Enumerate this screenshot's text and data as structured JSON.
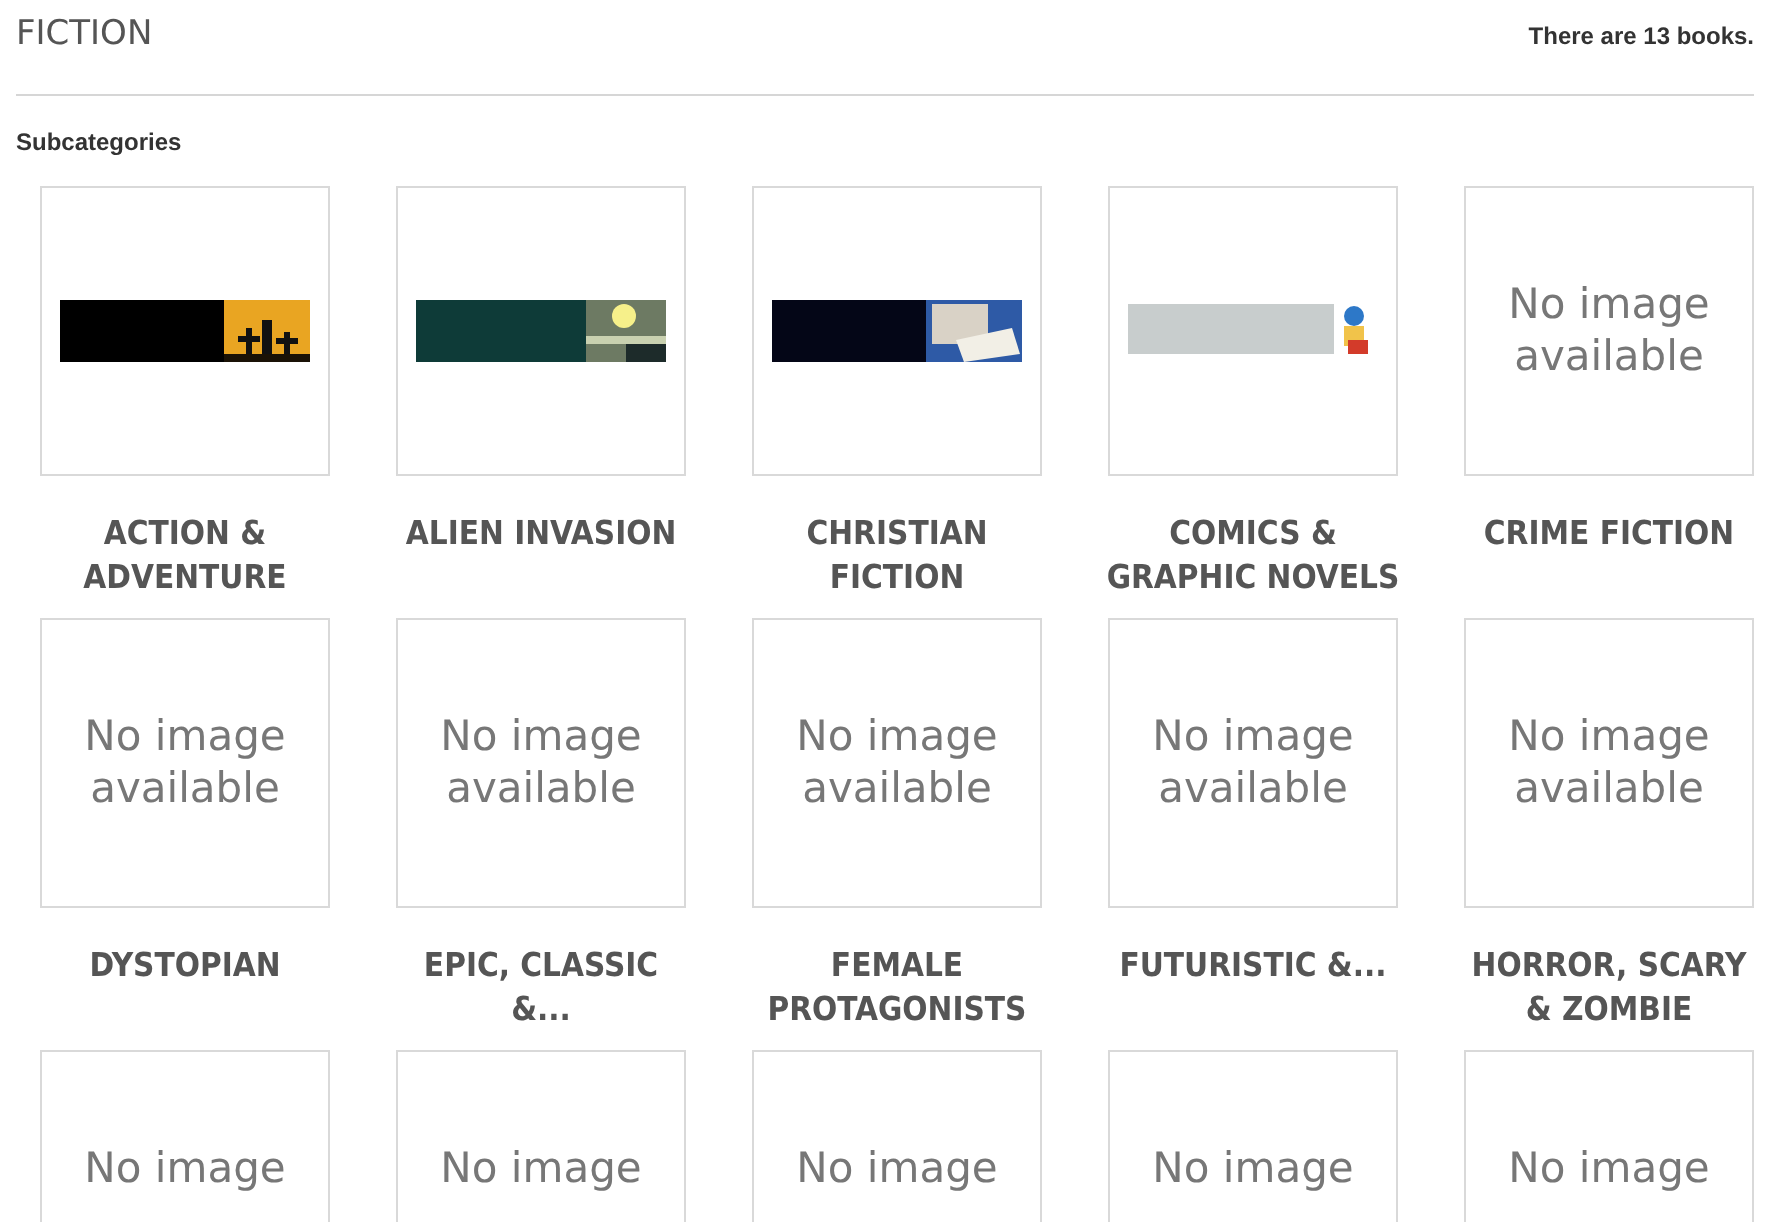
{
  "header": {
    "title": "FICTION",
    "count": "There are 13 books."
  },
  "section_title": "Subcategories",
  "subcategories": [
    {
      "name": "ACTION & ADVENTURE"
    },
    {
      "name": "ALIEN INVASION"
    },
    {
      "name": "CHRISTIAN FICTION"
    },
    {
      "name": "COMICS & GRAPHIC NOVELS"
    },
    {
      "name": "CRIME FICTION",
      "image": {
        "kind": "no_image",
        "text": "No image available"
      }
    },
    {
      "name": "DYSTOPIAN",
      "image": {
        "kind": "no_image",
        "text": "No image available"
      }
    },
    {
      "name": "EPIC, CLASSIC &...",
      "image": {
        "kind": "no_image",
        "text": "No image available"
      }
    },
    {
      "name": "FEMALE PROTAGONISTS",
      "image": {
        "kind": "no_image",
        "text": "No image available"
      }
    },
    {
      "name": "FUTURISTIC &...",
      "image": {
        "kind": "no_image",
        "text": "No image available"
      }
    },
    {
      "name": "HORROR, SCARY & ZOMBIE",
      "image": {
        "kind": "no_image",
        "text": "No image available"
      }
    },
    {
      "image": {
        "kind": "no_image",
        "text": "No image"
      }
    },
    {
      "image": {
        "kind": "no_image",
        "text": "No image"
      }
    },
    {
      "image": {
        "kind": "no_image",
        "text": "No image"
      }
    },
    {
      "image": {
        "kind": "no_image",
        "text": "No image"
      }
    },
    {
      "image": {
        "kind": "no_image",
        "text": "No image"
      }
    }
  ]
}
